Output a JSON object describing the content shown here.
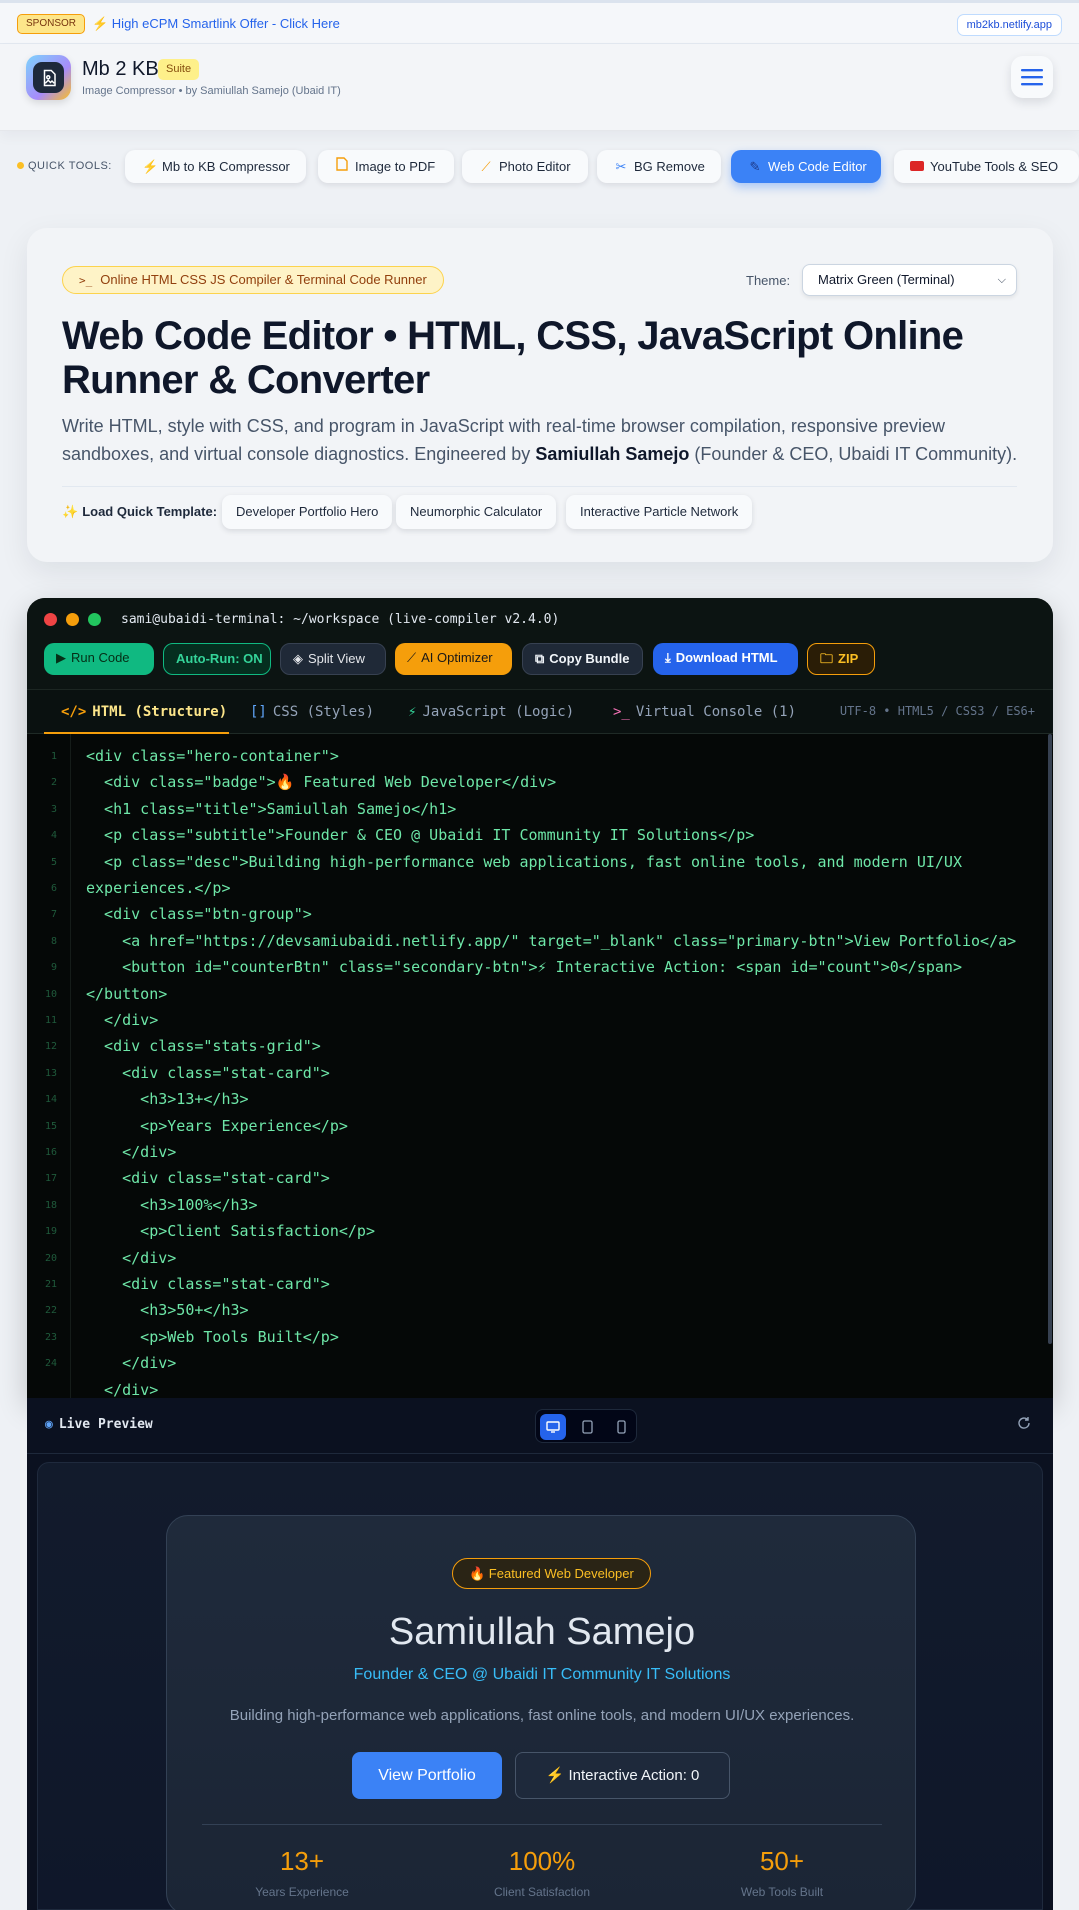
{
  "sponsor": {
    "tag": "SPONSOR",
    "link": "⚡ High eCPM Smartlink Offer - Click Here",
    "domain": "mb2kb.netlify.app"
  },
  "header": {
    "title": "Mb 2 KB",
    "badge": "Suite",
    "subtitle": "Image Compressor • by Samiullah Samejo (Ubaid IT)"
  },
  "quick_tools": {
    "label": "QUICK TOOLS:",
    "items": [
      {
        "label": "Mb to KB Compressor",
        "icon": "lightning-icon"
      },
      {
        "label": "Image to PDF",
        "icon": "document-icon"
      },
      {
        "label": "Photo Editor",
        "icon": "magic-wand-icon"
      },
      {
        "label": "BG Remove",
        "icon": "scissors-icon"
      },
      {
        "label": "Web Code Editor",
        "icon": "code-icon",
        "active": true
      },
      {
        "label": "YouTube Tools & SEO",
        "icon": "youtube-icon"
      }
    ]
  },
  "hero": {
    "badge": "Online HTML CSS JS Compiler & Terminal Code Runner",
    "theme_label": "Theme:",
    "theme_value": "Matrix Green (Terminal)",
    "title": "Web Code Editor • HTML, CSS, JavaScript Online Runner & Converter",
    "desc_before": "Write HTML, style with CSS, and program in JavaScript with real-time browser compilation, responsive preview sandboxes, and virtual console diagnostics. Engineered by ",
    "desc_name": "Samiullah Samejo",
    "desc_after": " (Founder & CEO, Ubaidi IT Community).",
    "template_label": "Load Quick Template:",
    "templates": [
      "Developer Portfolio Hero",
      "Neumorphic Calculator",
      "Interactive Particle Network"
    ]
  },
  "terminal": {
    "title": "sami@ubaidi-terminal: ~/workspace (live-compiler v2.4.0)",
    "buttons": {
      "run": "Run Code",
      "autorun": "Auto-Run: ON",
      "split": "Split View",
      "ai": "AI Optimizer",
      "copy": "Copy Bundle",
      "download": "Download HTML",
      "zip": "ZIP"
    },
    "tabs": [
      "HTML (Structure)",
      "CSS (Styles)",
      "JavaScript (Logic)",
      "Virtual Console (1)"
    ],
    "encoding": "UTF-8 • HTML5 / CSS3 / ES6+",
    "code_lines": [
      {
        "n": "1",
        "t": "<div class=\"hero-container\">"
      },
      {
        "n": "2",
        "t": "  <div class=\"badge\">🔥 Featured Web Developer</div>"
      },
      {
        "n": "3",
        "t": "  <h1 class=\"title\">Samiullah Samejo</h1>"
      },
      {
        "n": "4",
        "t": "  <p class=\"subtitle\">Founder & CEO @ Ubaidi IT Community IT Solutions</p>"
      },
      {
        "n": "5",
        "t": "  <p class=\"desc\">Building high-performance web applications, fast online tools, and modern UI/UX"
      },
      {
        "n": "6",
        "t": "experiences.</p>"
      },
      {
        "n": "7",
        "t": "  <div class=\"btn-group\">"
      },
      {
        "n": "8",
        "t": "    <a href=\"https://devsamiubaidi.netlify.app/\" target=\"_blank\" class=\"primary-btn\">View Portfolio</a>"
      },
      {
        "n": "9",
        "t": "    <button id=\"counterBtn\" class=\"secondary-btn\">⚡ Interactive Action: <span id=\"count\">0</span>"
      },
      {
        "n": "10",
        "t": "</button>"
      },
      {
        "n": "11",
        "t": "  </div>"
      },
      {
        "n": "12",
        "t": "  <div class=\"stats-grid\">"
      },
      {
        "n": "13",
        "t": "    <div class=\"stat-card\">"
      },
      {
        "n": "14",
        "t": "      <h3>13+</h3>"
      },
      {
        "n": "15",
        "t": "      <p>Years Experience</p>"
      },
      {
        "n": "16",
        "t": "    </div>"
      },
      {
        "n": "17",
        "t": "    <div class=\"stat-card\">"
      },
      {
        "n": "18",
        "t": "      <h3>100%</h3>"
      },
      {
        "n": "19",
        "t": "      <p>Client Satisfaction</p>"
      },
      {
        "n": "20",
        "t": "    </div>"
      },
      {
        "n": "21",
        "t": "    <div class=\"stat-card\">"
      },
      {
        "n": "22",
        "t": "      <h3>50+</h3>"
      },
      {
        "n": "23",
        "t": "      <p>Web Tools Built</p>"
      },
      {
        "n": "24",
        "t": "    </div>"
      },
      {
        "n": "",
        "t": "  </div>"
      }
    ]
  },
  "preview": {
    "label": "Live Preview",
    "badge": "🔥 Featured Web Developer",
    "name": "Samiullah Samejo",
    "subtitle": "Founder & CEO @ Ubaidi IT Community IT Solutions",
    "desc": "Building high-performance web applications, fast online tools, and modern UI/UX experiences.",
    "primary": "View Portfolio",
    "secondary": "⚡ Interactive Action: 0",
    "stats": [
      {
        "value": "13+",
        "label": "Years Experience"
      },
      {
        "value": "100%",
        "label": "Client Satisfaction"
      },
      {
        "value": "50+",
        "label": "Web Tools Built"
      }
    ]
  }
}
